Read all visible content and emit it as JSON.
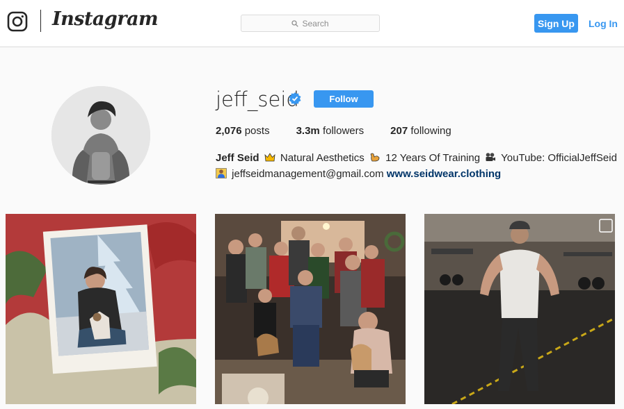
{
  "header": {
    "brand_name": "Instagram",
    "search_placeholder": "Search",
    "signup_label": "Sign Up",
    "login_label": "Log In",
    "accent_color": "#3897f0"
  },
  "profile": {
    "username": "jeff_seid",
    "verified_icon": "verified-badge-icon",
    "follow_label": "Follow",
    "posts_count": "2,076",
    "posts_label": "posts",
    "followers_count": "3.3m",
    "followers_label": "followers",
    "following_count": "207",
    "following_label": "following",
    "full_name": "Jeff Seid",
    "bio_part1": "Natural Aesthetics",
    "bio_part2": "12 Years Of Training",
    "bio_part3": "YouTube: OfficialJeffSeid",
    "email": "jeffseidmanagement@gmail.com",
    "website": "www.seidwear.clothing"
  },
  "posts": [
    {
      "name": "post-polaroid-dog"
    },
    {
      "name": "post-family-group"
    },
    {
      "name": "post-gym"
    }
  ]
}
